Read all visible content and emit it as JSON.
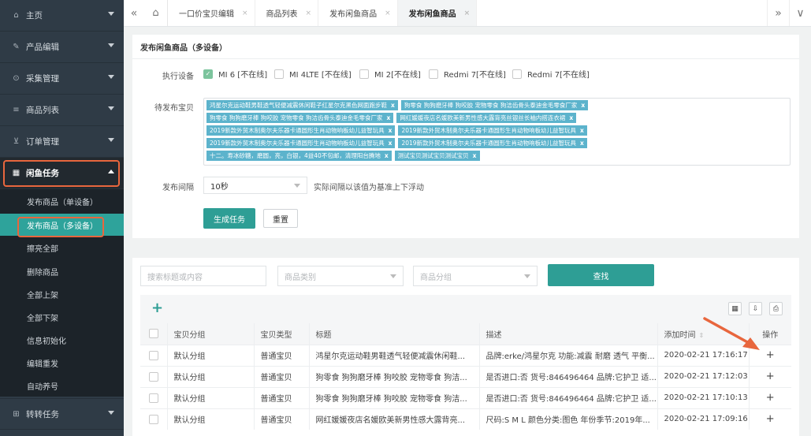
{
  "sidebar": {
    "items": [
      {
        "label": "主页",
        "icon": "home-icon"
      },
      {
        "label": "产品编辑",
        "icon": "edit-icon"
      },
      {
        "label": "采集管理",
        "icon": "collect-icon"
      },
      {
        "label": "商品列表",
        "icon": "list-icon"
      },
      {
        "label": "订单管理",
        "icon": "cart-icon"
      },
      {
        "label": "闲鱼任务",
        "icon": "task-icon"
      }
    ],
    "submenu": [
      "发布商品（单设备）",
      "发布商品（多设备）",
      "擦亮全部",
      "删除商品",
      "全部上架",
      "全部下架",
      "信息初始化",
      "编辑重发",
      "自动养号"
    ],
    "last_item": {
      "label": "转转任务",
      "icon": "transfer-icon"
    }
  },
  "tabs": {
    "items": [
      "一口价宝贝编辑",
      "商品列表",
      "发布闲鱼商品",
      "发布闲鱼商品"
    ],
    "close": "×",
    "nav_left": "«",
    "nav_right": "»",
    "dropdown": "∨"
  },
  "form": {
    "title": "发布闲鱼商品（多设备）",
    "device_label": "执行设备",
    "devices": [
      {
        "label": "MI 6 [不在线]",
        "checked": true
      },
      {
        "label": "MI 4LTE [不在线]",
        "checked": false
      },
      {
        "label": "MI 2[不在线]",
        "checked": false
      },
      {
        "label": "Redmi 7[不在线]",
        "checked": false
      },
      {
        "label": "Redmi 7[不在线]",
        "checked": false
      }
    ],
    "pending_label": "待发布宝贝",
    "tags": [
      [
        "鸿星尔克运动鞋男鞋透气轻便减震休闲鞋子红星尔克黑色网面跑步鞋",
        "狗零食 狗狗磨牙棒 狗咬胶 宠物零食 狗洁齿骨头泰迪金毛零食厂家"
      ],
      [
        "狗零食 狗狗磨牙棒 狗咬胶 宠物零食 狗洁齿骨头泰迪金毛零食厂家",
        "网红媛媛夜店名媛欧美新男性感大露背亮丝银丝长袖内搭连衣裙"
      ],
      [
        "2019新款外贸木制奥尔夫乐器卡通圆形生肖动物响板幼儿益智玩具",
        "2019新款外贸木制奥尔夫乐器卡通圆形生肖动物响板幼儿益智玩具"
      ],
      [
        "2019新款外贸木制奥尔夫乐器卡通圆形生肖动物响板幼儿益智玩具",
        "2019新款外贸木制奥尔夫乐器卡通圆形生肖动物响板幼儿益智玩具"
      ],
      [
        "十二。寿冰砂糖，磨圆，亮，白银，4益40不包邮，清理阳台腾地",
        "测试宝贝测试宝贝测试宝贝"
      ]
    ],
    "tag_close": "x",
    "interval_label": "发布间隔",
    "interval_value": "10秒",
    "interval_hint": "实际间隔以该值为基准上下浮动",
    "generate_btn": "生成任务",
    "reset_btn": "重置"
  },
  "search": {
    "keyword_placeholder": "搜索标题或内容",
    "category_placeholder": "商品类别",
    "group_placeholder": "商品分组",
    "search_btn": "查找"
  },
  "table": {
    "headers": [
      "",
      "宝贝分组",
      "宝贝类型",
      "标题",
      "描述",
      "添加时间",
      "操作"
    ],
    "rows": [
      [
        "默认分组",
        "普通宝贝",
        "鸿星尔克运动鞋男鞋透气轻便减震休闲鞋...",
        "品牌:erke/鸿星尔克 功能:减震 耐磨 透气 平衡...",
        "2020-02-21 17:16:17",
        "+"
      ],
      [
        "默认分组",
        "普通宝贝",
        "狗零食 狗狗磨牙棒 狗咬胶 宠物零食 狗洁...",
        "是否进口:否 货号:846496464 品牌:它护卫 适...",
        "2020-02-21 17:12:03",
        "+"
      ],
      [
        "默认分组",
        "普通宝贝",
        "狗零食 狗狗磨牙棒 狗咬胶 宠物零食 狗洁...",
        "是否进口:否 货号:846496464 品牌:它护卫 适...",
        "2020-02-21 17:10:13",
        "+"
      ],
      [
        "默认分组",
        "普通宝贝",
        "网红媛媛夜店名媛欧美新男性感大露背亮...",
        "尺码:S M L 颜色分类:图色 年份季节:2019年...",
        "2020-02-21 17:09:16",
        "+"
      ]
    ],
    "add": "+"
  },
  "colors": {
    "accent": "#2e9e95",
    "sidebar": "#2f3b46",
    "highlight": "#e8663d",
    "tag": "#5cb3cc"
  }
}
